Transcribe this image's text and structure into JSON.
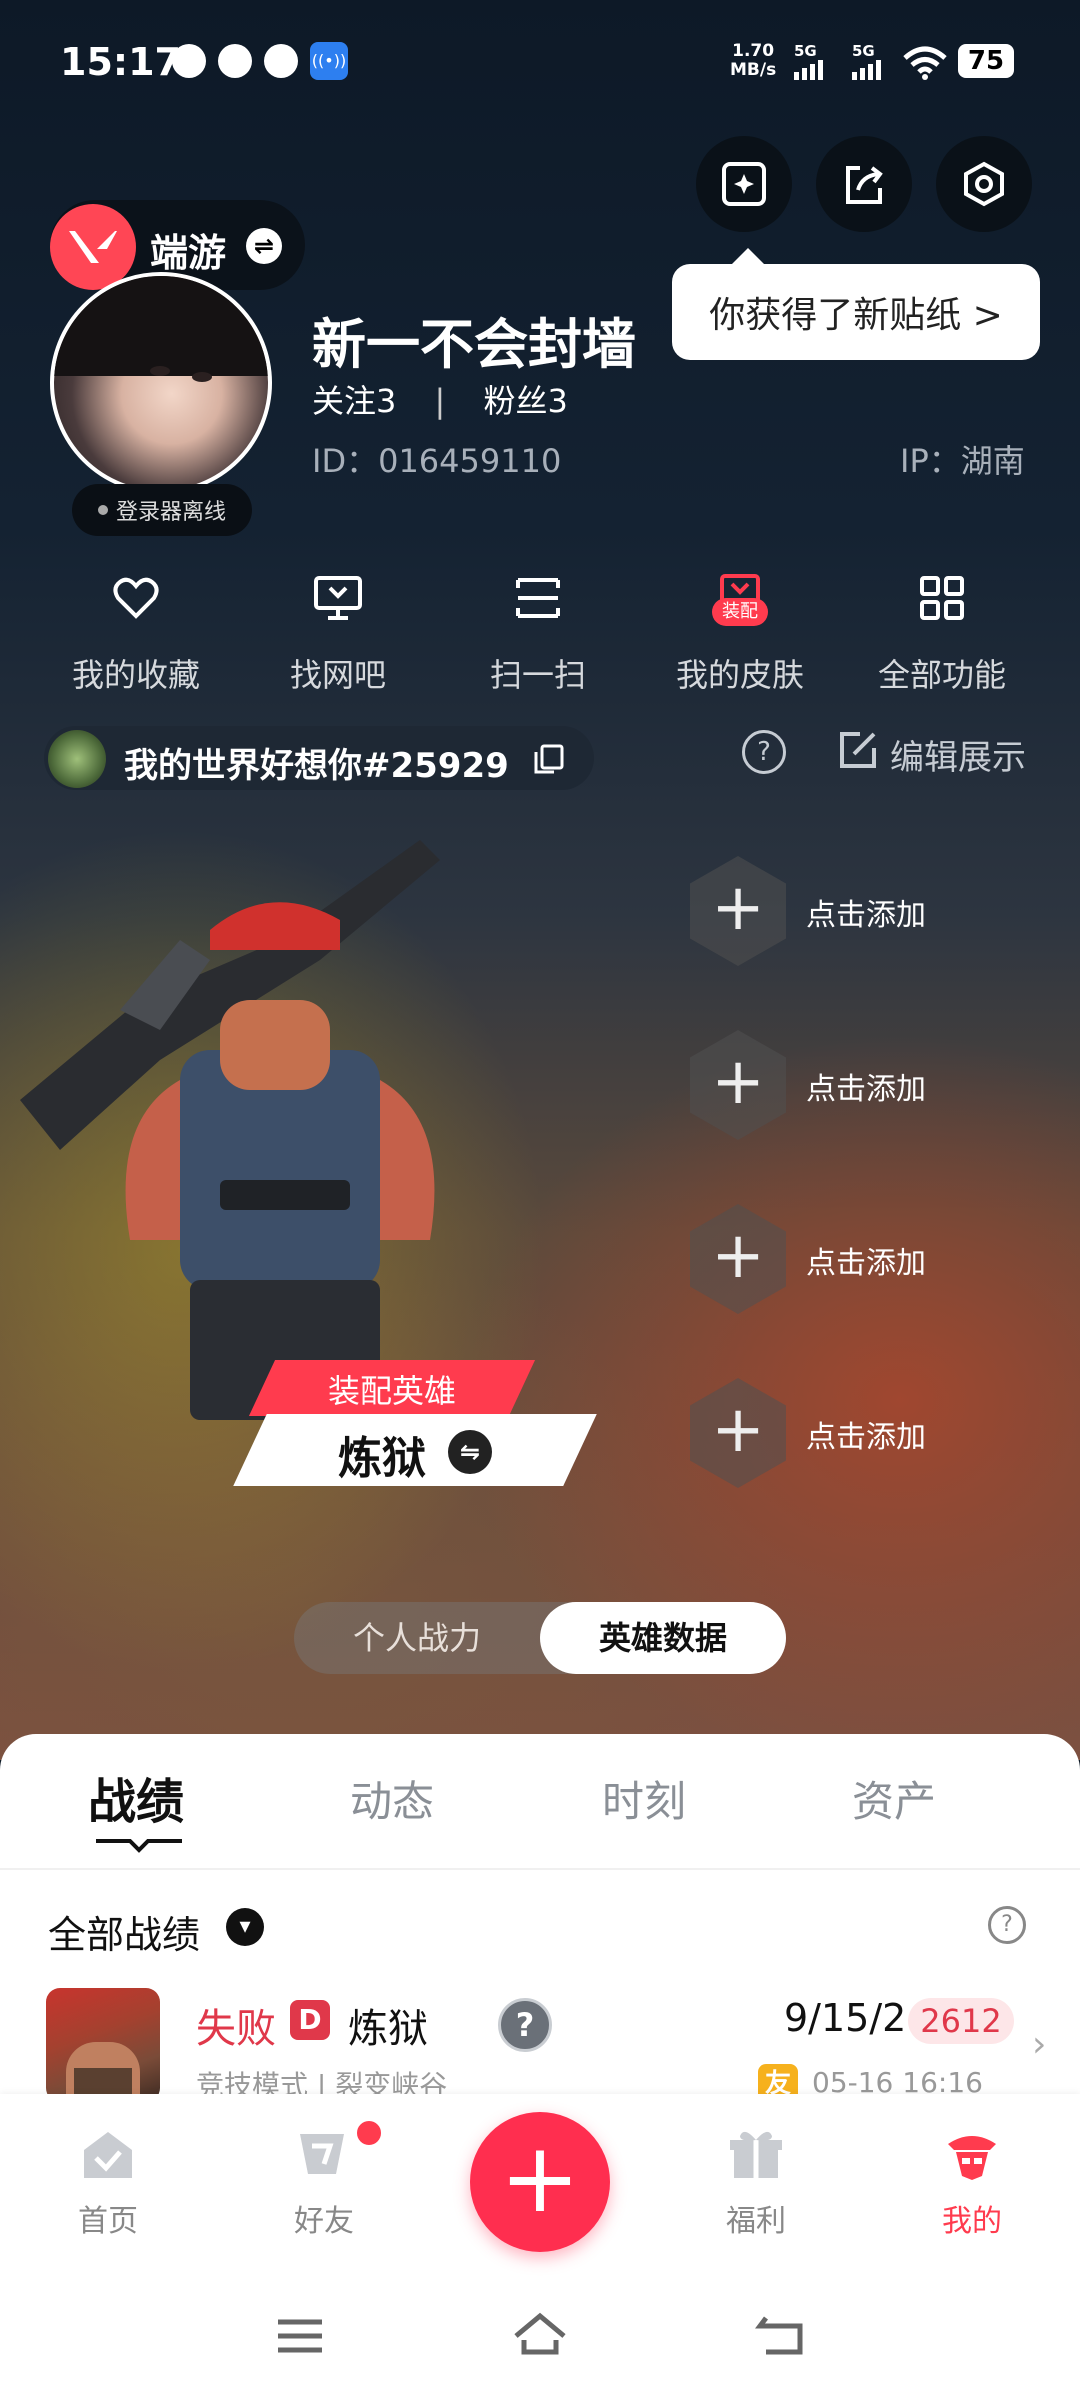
{
  "status_bar": {
    "time": "15:17",
    "net_speed_value": "1.70",
    "net_speed_unit": "MB/s",
    "sim1": "5G",
    "sim2": "5G",
    "battery": "75"
  },
  "header": {
    "tooltip": "你获得了新贴纸 >",
    "game_name": "端游",
    "online_status": "登录器离线",
    "username": "新一不会封墙",
    "follow_label": "关注",
    "follow_count": "3",
    "fans_label": "粉丝",
    "fans_count": "3",
    "id_text": "ID：016459110",
    "ip_text": "IP：湖南"
  },
  "quick_actions": [
    {
      "label": "我的收藏",
      "icon": "heart-icon"
    },
    {
      "label": "找网吧",
      "icon": "monitor-icon"
    },
    {
      "label": "扫一扫",
      "icon": "scan-icon"
    },
    {
      "label": "我的皮肤",
      "icon": "skin-icon",
      "badge": "装配"
    },
    {
      "label": "全部功能",
      "icon": "grid-icon"
    }
  ],
  "game_account": {
    "server_name": "我的世界好想你#25929",
    "edit_label": "编辑展示"
  },
  "hero": {
    "tag": "装配英雄",
    "name": "炼狱",
    "slots": [
      "点击添加",
      "点击添加",
      "点击添加",
      "点击添加"
    ]
  },
  "segment": {
    "personal": "个人战力",
    "hero_data": "英雄数据",
    "selected": "英雄数据"
  },
  "tabs": [
    "战绩",
    "动态",
    "时刻",
    "资产"
  ],
  "records": {
    "filter_label": "全部战绩",
    "items": [
      {
        "result": "失败",
        "mode_badge": "D",
        "hero": "炼狱",
        "kda": "9/15/2",
        "score": "2612",
        "subtitle": "竞技模式 | 裂变峡谷",
        "friend_badge": "友",
        "time": "05-16 16:16"
      }
    ]
  },
  "bottom_nav": [
    {
      "label": "首页",
      "icon": "home-icon"
    },
    {
      "label": "好友",
      "icon": "friends-icon"
    },
    {
      "label": "",
      "icon": "plus-icon"
    },
    {
      "label": "福利",
      "icon": "gift-icon"
    },
    {
      "label": "我的",
      "icon": "me-icon",
      "active": true
    }
  ],
  "colors": {
    "accent": "#ff3b4e",
    "valorant_red": "#ff4655"
  }
}
